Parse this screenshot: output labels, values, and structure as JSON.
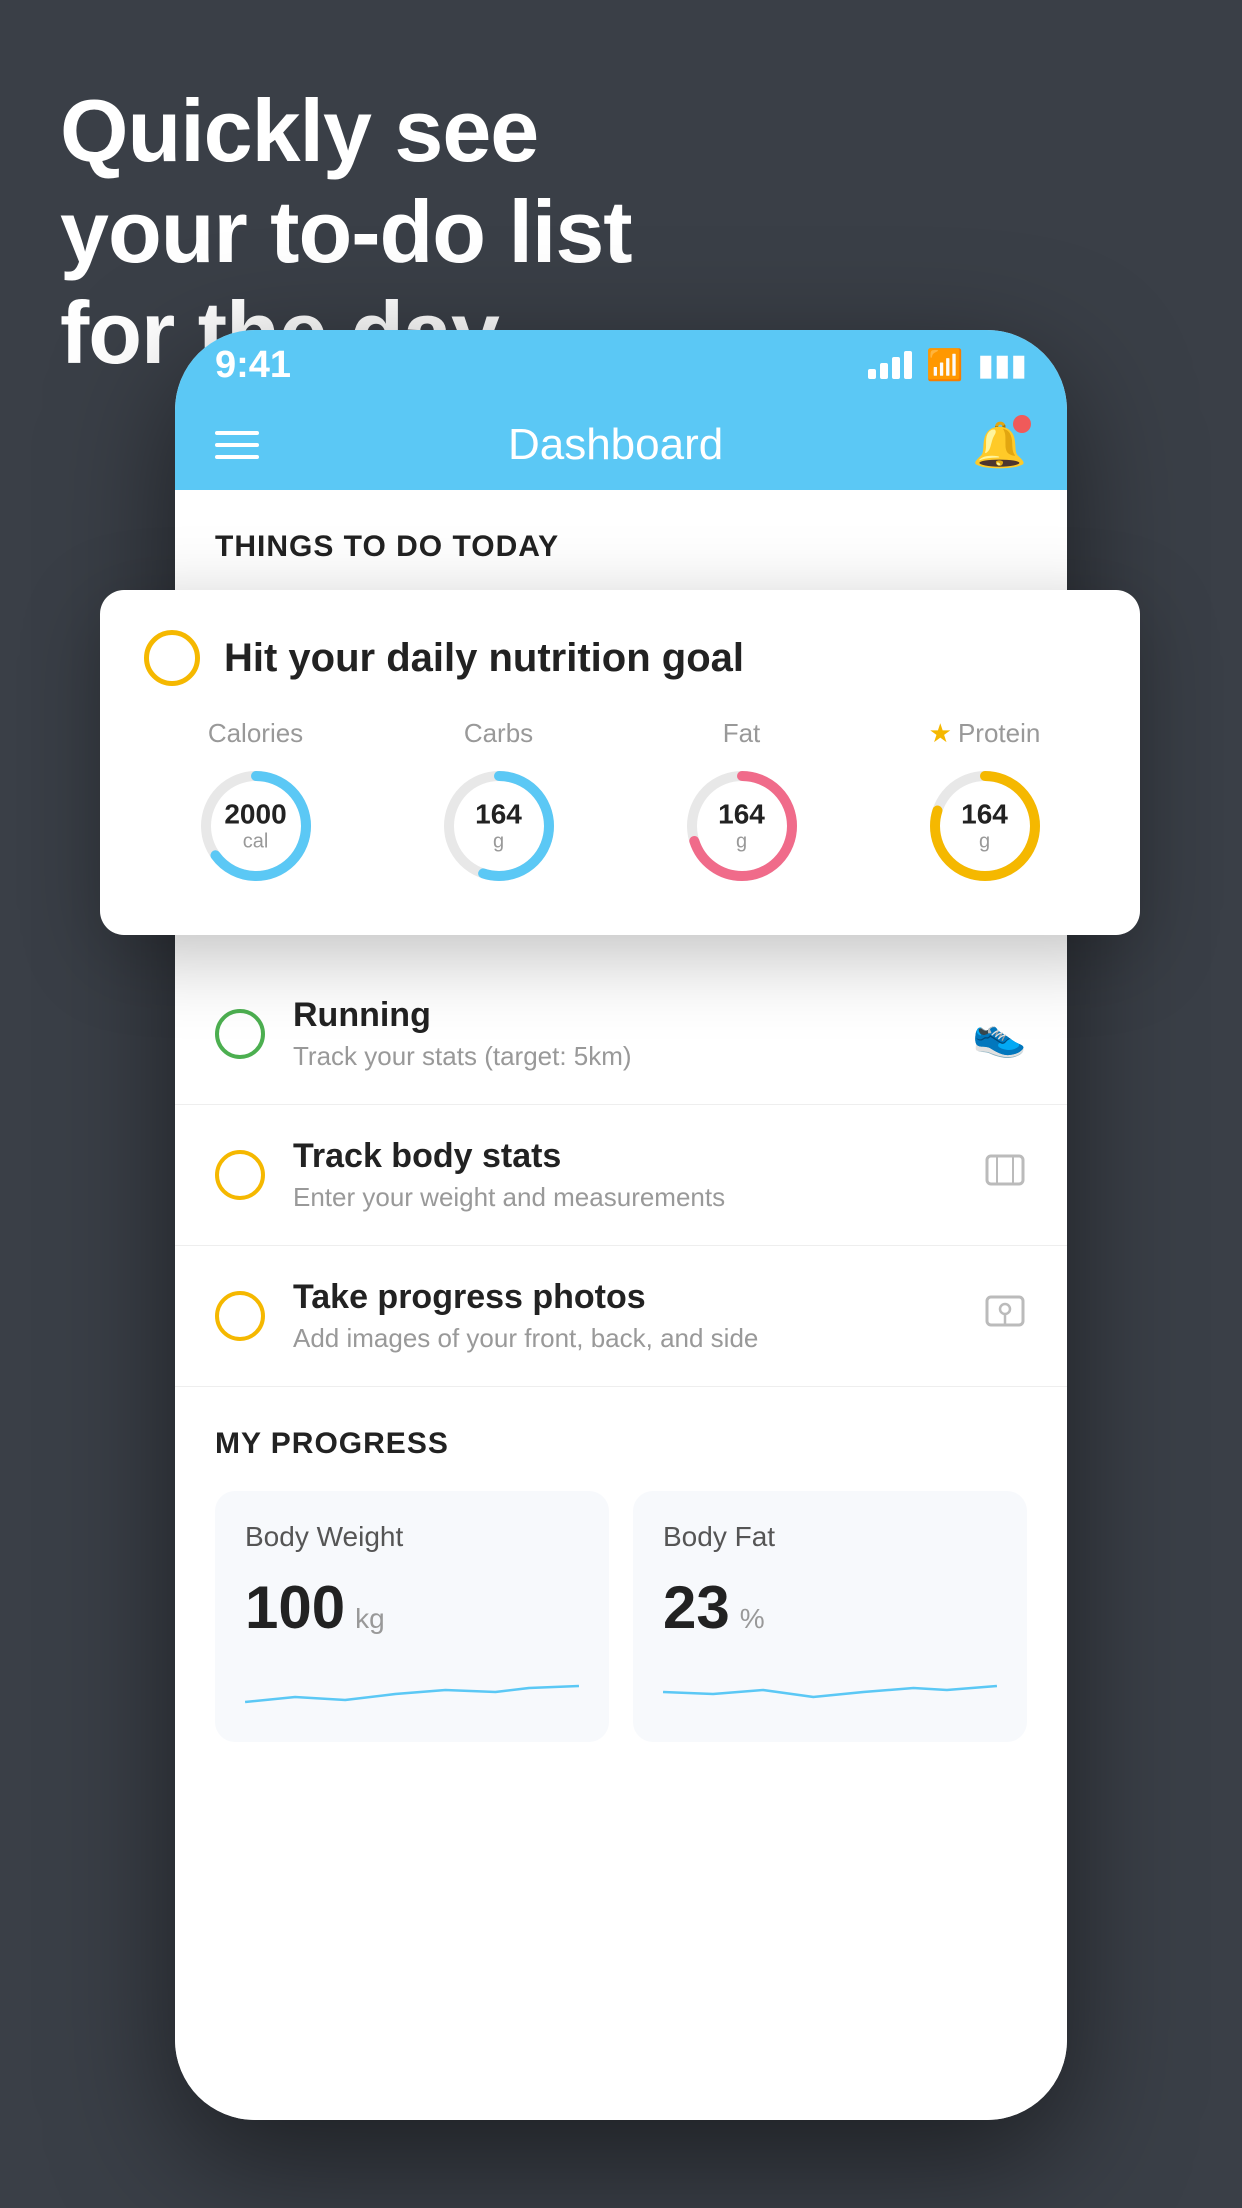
{
  "page": {
    "background_color": "#3a3f47",
    "headline": {
      "line1": "Quickly see",
      "line2": "your to-do list",
      "line3": "for the day."
    }
  },
  "phone": {
    "status_bar": {
      "time": "9:41",
      "signal_label": "signal",
      "wifi_label": "wifi",
      "battery_label": "battery"
    },
    "nav_bar": {
      "menu_label": "menu",
      "title": "Dashboard",
      "bell_label": "notifications"
    },
    "section_today": {
      "title": "THINGS TO DO TODAY"
    },
    "floating_card": {
      "title": "Hit your daily nutrition goal",
      "nutrition": [
        {
          "label": "Calories",
          "value": "2000",
          "unit": "cal",
          "color": "#5bc8f5",
          "percent": 65,
          "starred": false
        },
        {
          "label": "Carbs",
          "value": "164",
          "unit": "g",
          "color": "#5bc8f5",
          "percent": 55,
          "starred": false
        },
        {
          "label": "Fat",
          "value": "164",
          "unit": "g",
          "color": "#f06b8a",
          "percent": 70,
          "starred": false
        },
        {
          "label": "Protein",
          "value": "164",
          "unit": "g",
          "color": "#f5b800",
          "percent": 80,
          "starred": true
        }
      ]
    },
    "todo_items": [
      {
        "id": 1,
        "name": "Running",
        "desc": "Track your stats (target: 5km)",
        "circle_color": "green",
        "icon": "👟"
      },
      {
        "id": 2,
        "name": "Track body stats",
        "desc": "Enter your weight and measurements",
        "circle_color": "yellow",
        "icon": "⊞"
      },
      {
        "id": 3,
        "name": "Take progress photos",
        "desc": "Add images of your front, back, and side",
        "circle_color": "yellow",
        "icon": "👤"
      }
    ],
    "progress_section": {
      "title": "MY PROGRESS",
      "cards": [
        {
          "title": "Body Weight",
          "value": "100",
          "unit": "kg"
        },
        {
          "title": "Body Fat",
          "value": "23",
          "unit": "%"
        }
      ]
    }
  }
}
